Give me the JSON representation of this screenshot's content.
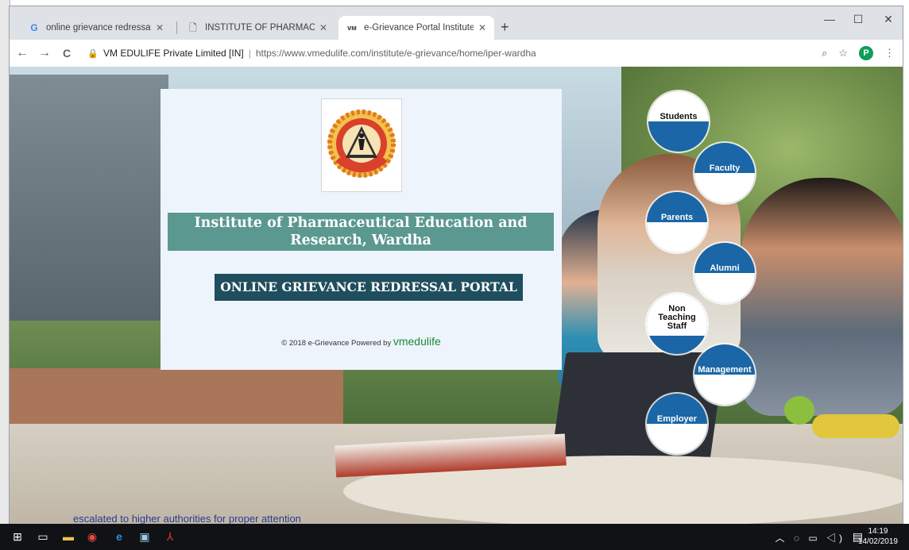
{
  "browser": {
    "tabs": [
      {
        "icon": "google-icon",
        "title": "online grievance redressal mecha"
      },
      {
        "icon": "document-icon",
        "title": "INSTITUTE OF PHARMACEUTICA"
      },
      {
        "icon": "vm-icon",
        "title": "e-Grievance Portal Institute of Ph"
      }
    ],
    "new_tab": "+",
    "window_controls": {
      "minimize": "—",
      "maximize": "☐",
      "close": "✕"
    },
    "nav": {
      "back": "←",
      "forward": "→",
      "reload": "C"
    },
    "address": {
      "site_identity": "VM EDULIFE Private Limited [IN]",
      "separator": "|",
      "url": "https://www.vmedulife.com/institute/e-grievance/home/iper-wardha"
    },
    "profile_initial": "P"
  },
  "panel": {
    "institute_name": "Institute of Pharmaceutical Education and Research, Wardha",
    "portal_title": "ONLINE GRIEVANCE REDRESSAL PORTAL",
    "footer_text": "© 2018 e-Grievance Powered by ",
    "footer_brand": "vmedulife"
  },
  "login_options": [
    {
      "label": "Students"
    },
    {
      "label": "Faculty"
    },
    {
      "label": "Parents"
    },
    {
      "label": "Alumni"
    },
    {
      "label": "Non Teaching Staff"
    },
    {
      "label": "Management"
    },
    {
      "label": "Employer"
    }
  ],
  "background_text": "escalated to higher authorities for proper attention",
  "taskbar": {
    "time": "14:19",
    "date": "14/02/2019"
  },
  "colors": {
    "banner": "#5b9890",
    "portal_title": "#1f4e5e",
    "circle_blue": "#1a66a6",
    "brand_green": "#1b8a3a"
  }
}
